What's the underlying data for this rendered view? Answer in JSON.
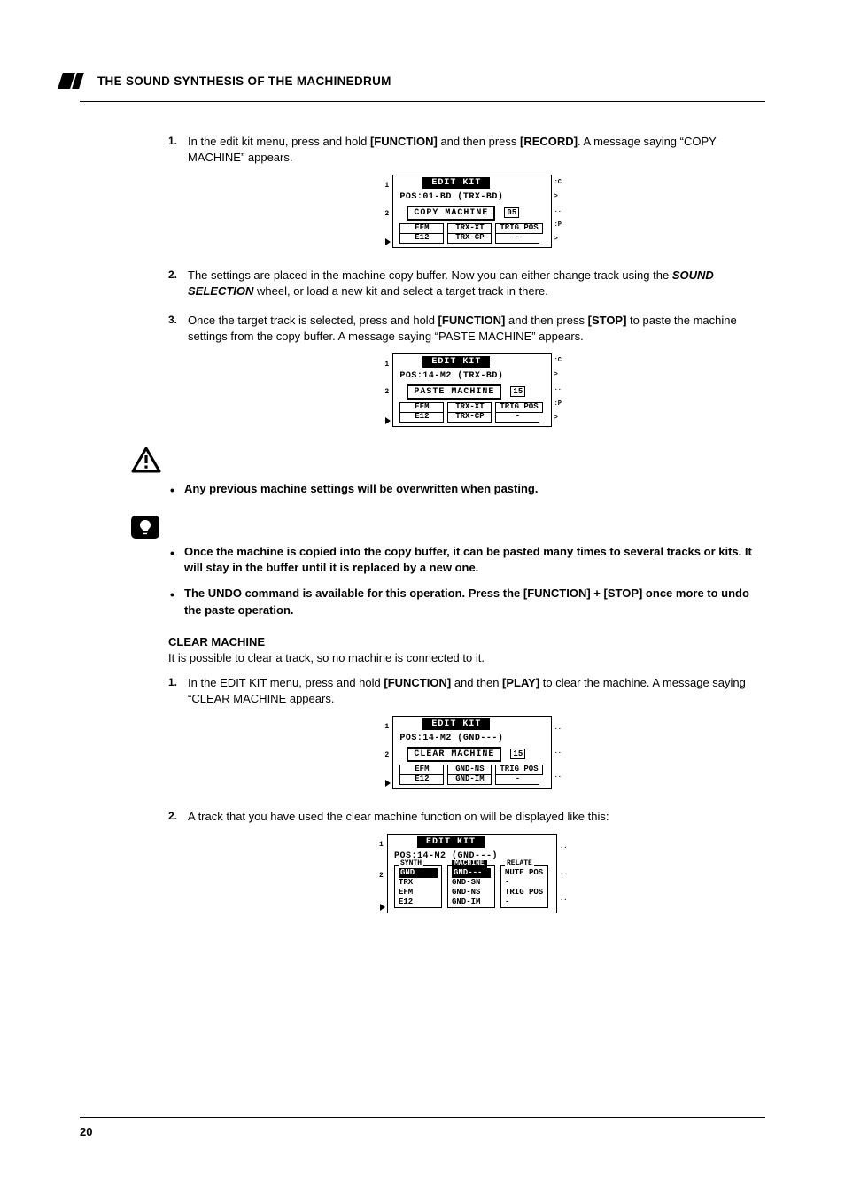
{
  "header": {
    "section_title": "THE SOUND SYNTHESIS OF THE MACHINEDRUM"
  },
  "steps_a": [
    {
      "n": "1.",
      "text_pre": "In the edit kit menu, press and hold ",
      "b1": "[FUNCTION]",
      "mid": " and then press ",
      "b2": "[RECORD]",
      "post": ". A message saying “COPY MACHINE” appears."
    },
    {
      "n": "2.",
      "text_pre": "The settings are placed in the machine copy buffer. Now you can either change track using the ",
      "ib": "SOUND SELECTION",
      "post": " wheel, or load a new kit and select a target track in there."
    },
    {
      "n": "3.",
      "text_pre": "Once the target track is selected, press and hold ",
      "b1": "[FUNCTION]",
      "mid": " and then press ",
      "b2": "[STOP]",
      "post": " to paste the machine settings from the copy buffer. A message saying “PASTE MACHINE” appears."
    }
  ],
  "lcd1": {
    "title": "EDIT KIT",
    "pos": "POS:01-BD (TRX-BD)",
    "toast": "COPY MACHINE",
    "cells": [
      "EFM",
      "TRX-XT",
      "TRIG POS"
    ],
    "cells2": [
      "E12",
      "TRX-CP",
      "-"
    ],
    "tnumL": "05"
  },
  "lcd2": {
    "title": "EDIT KIT",
    "pos": "POS:14-M2 (TRX-BD)",
    "toast": "PASTE MACHINE",
    "cells": [
      "EFM",
      "TRX-XT",
      "TRIG POS"
    ],
    "cells2": [
      "E12",
      "TRX-CP",
      "-"
    ],
    "tnumL": "15"
  },
  "warning_bullets": [
    "Any previous machine settings will be overwritten when pasting."
  ],
  "tip_bullets": [
    "Once the machine is copied into the copy buffer, it can be pasted many times to several tracks or kits. It will stay in the buffer until it is replaced by a new one.",
    "The UNDO command is available for this operation. Press the [FUNCTION] + [STOP] once more to undo the paste operation."
  ],
  "clear": {
    "heading": "CLEAR MACHINE",
    "intro": "It is possible to clear a track, so no machine is connected to it."
  },
  "steps_b": [
    {
      "n": "1.",
      "text_pre": "In the EDIT KIT menu, press and hold ",
      "b1": "[FUNCTION]",
      "mid": " and then ",
      "b2": "[PLAY]",
      "post": " to clear the machine. A message saying “CLEAR MACHINE appears."
    },
    {
      "n": "2.",
      "text_pre": " A track that you have used the clear machine function on will be displayed like this:"
    }
  ],
  "lcd3": {
    "title": "EDIT KIT",
    "pos": "POS:14-M2 (GND---)",
    "toast": "CLEAR MACHINE",
    "cells": [
      "EFM",
      "GND-NS",
      "TRIG POS"
    ],
    "cells2": [
      "E12",
      "GND-IM",
      "-"
    ],
    "tnumL": "15"
  },
  "lcd4": {
    "title": "EDIT KIT",
    "pos": "POS:14-M2 (GND---)",
    "g1": {
      "hdr": "SYNTH",
      "items": [
        "GND",
        "TRX",
        "EFM",
        "E12"
      ]
    },
    "g2": {
      "hdr": "MACHINE",
      "items": [
        "GND---",
        "GND-SN",
        "GND-NS",
        "GND-IM"
      ]
    },
    "g3": {
      "hdr": "RELATE",
      "items": [
        "MUTE POS",
        "-",
        "TRIG POS",
        "-"
      ]
    }
  },
  "page_number": "20"
}
